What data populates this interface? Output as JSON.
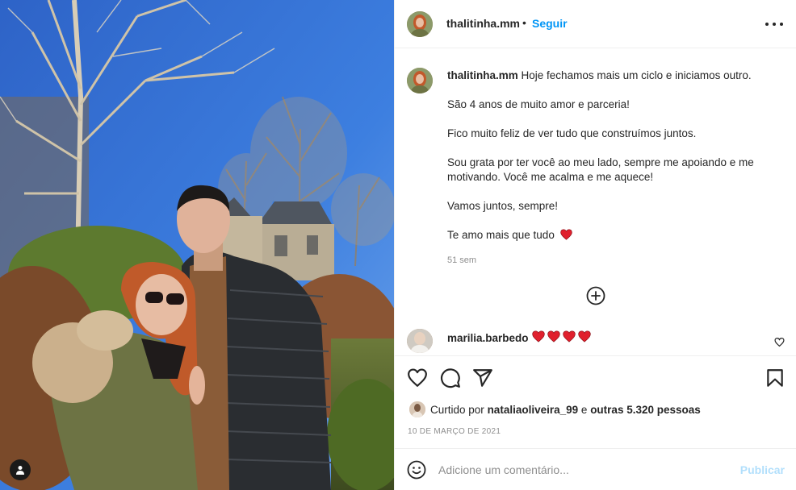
{
  "post": {
    "username": "thalitinha.mm",
    "separator": "•",
    "follow_label": "Seguir"
  },
  "caption": {
    "username": "thalitinha.mm",
    "first_line": "Hoje fechamos mais um ciclo e iniciamos outro.",
    "paragraphs": [
      "São 4 anos de muito amor e parceria!",
      "Fico muito feliz de ver tudo que construímos juntos.",
      "Sou grata por ter você ao meu lado, sempre me apoiando e me motivando. Você me acalma e me aquece!",
      "Vamos juntos, sempre!"
    ],
    "last_line": "Te amo mais que tudo",
    "time_ago": "51 sem"
  },
  "comment": {
    "username": "marilia.barbedo",
    "heart_count": 4
  },
  "likes": {
    "prefix": "Curtido por",
    "user": "nataliaoliveira_99",
    "connector": "e",
    "others": "outras 5.320 pessoas"
  },
  "date": "10 DE MARÇO DE 2021",
  "add_comment": {
    "placeholder": "Adicione um comentário...",
    "publish_label": "Publicar"
  },
  "icons": {
    "more": "more-horizontal-icon",
    "load_more": "plus-circle-icon",
    "like": "heart-outline-icon",
    "comment": "speech-bubble-icon",
    "share": "paper-plane-icon",
    "save": "bookmark-icon",
    "emoji": "smiley-icon",
    "tag": "person-tag-icon"
  },
  "colors": {
    "link": "#0095f6",
    "publish_disabled": "#b2dffc",
    "heart": "#ed4956",
    "muted": "#8e8e8e"
  }
}
